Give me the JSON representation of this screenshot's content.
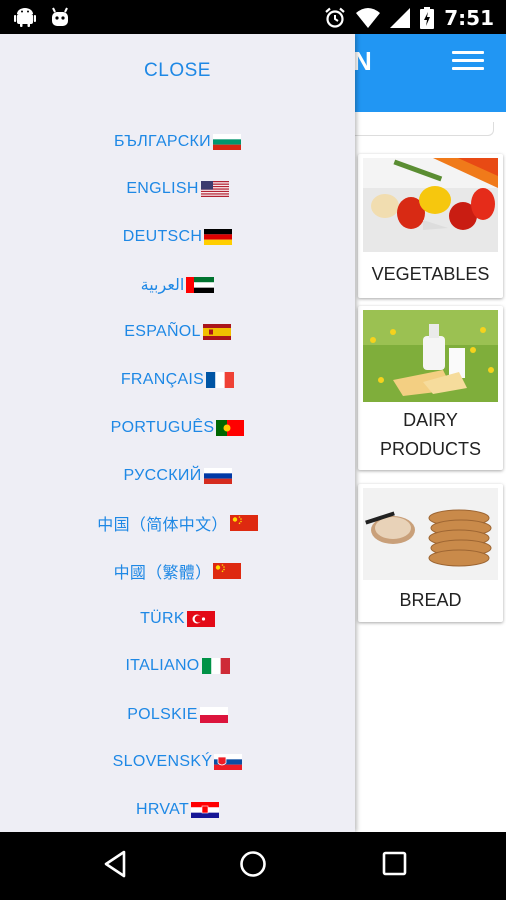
{
  "status_bar": {
    "time": "7:51",
    "icons": [
      "android-icon",
      "android-debug-icon",
      "alarm-icon",
      "wifi-icon",
      "signal-icon",
      "battery-charging-icon"
    ]
  },
  "app": {
    "header_title_fragment": "N",
    "menu_icon": "hamburger-menu-icon",
    "categories": [
      {
        "label": "VEGETABLES"
      },
      {
        "label_line1": "DAIRY",
        "label_line2": "PRODUCTS"
      },
      {
        "label": "BREAD"
      }
    ]
  },
  "drawer": {
    "close_label": "CLOSE",
    "languages": [
      {
        "label": "БЪЛГАРСКИ",
        "flag": "bulgaria-flag-icon"
      },
      {
        "label": "ENGLISH",
        "flag": "usa-flag-icon"
      },
      {
        "label": "DEUTSCH",
        "flag": "germany-flag-icon"
      },
      {
        "label": "العربية",
        "flag": "uae-flag-icon"
      },
      {
        "label": "ESPAÑOL",
        "flag": "spain-flag-icon"
      },
      {
        "label": "FRANÇAIS",
        "flag": "france-flag-icon"
      },
      {
        "label": "PORTUGUÊS",
        "flag": "portugal-flag-icon"
      },
      {
        "label": "РУССКИЙ",
        "flag": "russia-flag-icon"
      },
      {
        "label": "中国（简体中文）",
        "flag": "china-flag-icon"
      },
      {
        "label": "中國（繁體）",
        "flag": "china-flag-icon"
      },
      {
        "label": "TÜRK",
        "flag": "turkey-flag-icon"
      },
      {
        "label": "ITALIANO",
        "flag": "italy-flag-icon"
      },
      {
        "label": "POLSKIE",
        "flag": "poland-flag-icon"
      },
      {
        "label": "SLOVENSKÝ",
        "flag": "slovakia-flag-icon"
      },
      {
        "label": "HRVAT",
        "flag": "croatia-flag-icon"
      }
    ]
  },
  "nav_bar": {
    "icons": [
      "back-icon",
      "home-icon",
      "recents-icon"
    ]
  },
  "colors": {
    "accent": "#1e88e5",
    "header": "#2196f3",
    "drawer_bg": "#eeeef5"
  }
}
